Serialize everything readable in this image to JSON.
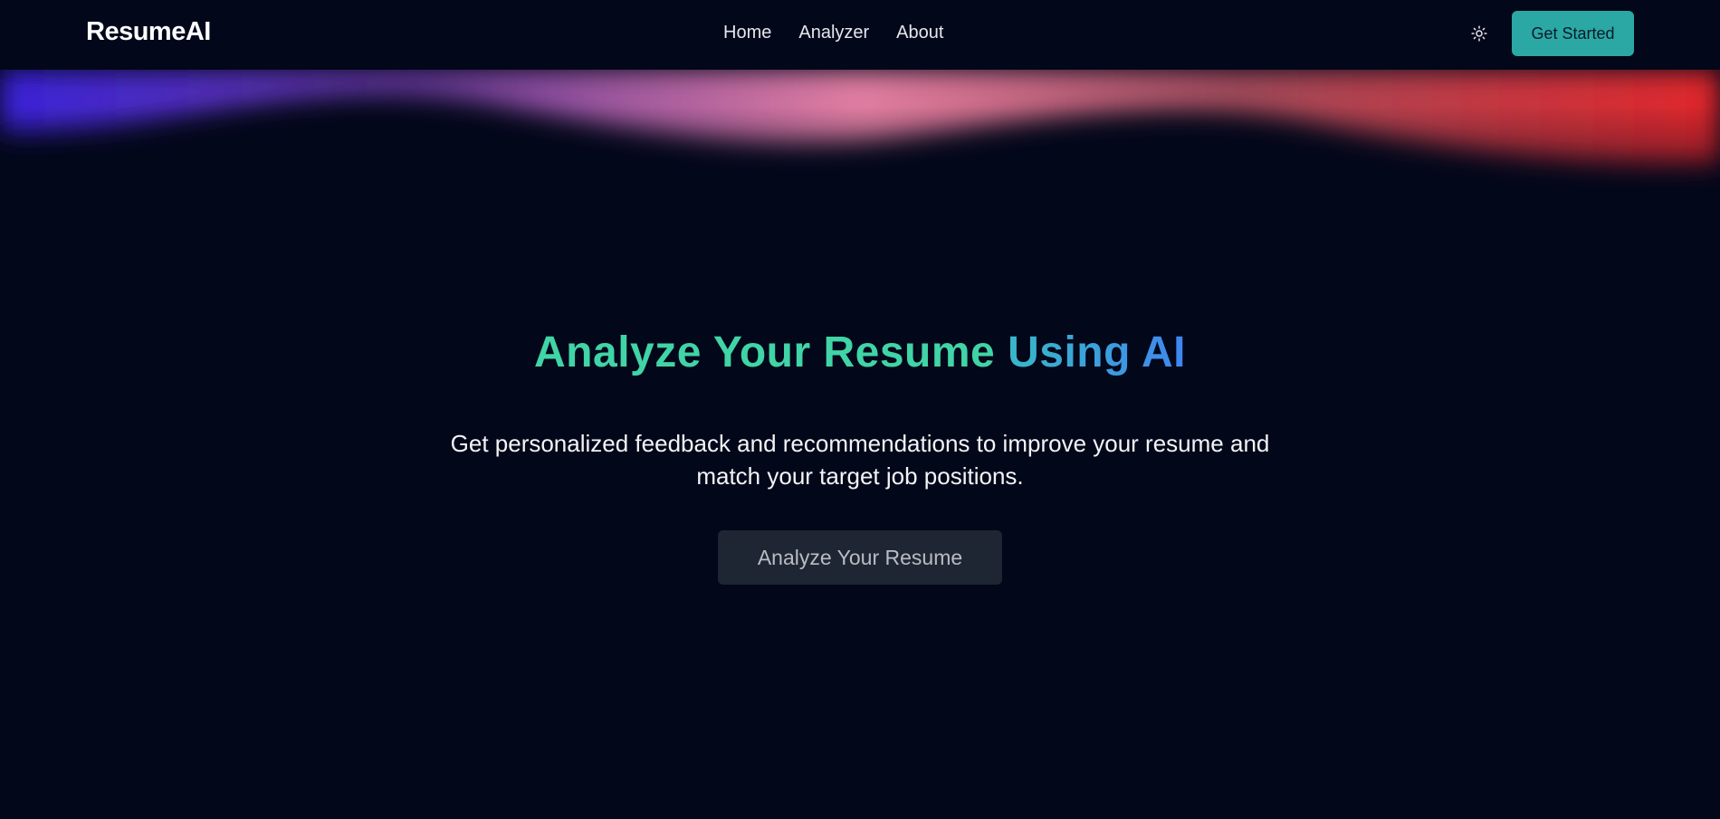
{
  "nav": {
    "logo": "ResumeAI",
    "links": [
      "Home",
      "Analyzer",
      "About"
    ],
    "theme_icon": "sun-icon",
    "cta_label": "Get Started"
  },
  "hero": {
    "title_part_a": "Analyze Your Resume",
    "title_part_b": "Using AI",
    "subtitle_line1": "Get personalized feedback and recommendations to improve your resume and",
    "subtitle_line2": "match your target job positions.",
    "button_label": "Analyze Your Resume"
  },
  "colors": {
    "background": "#03071a",
    "accent_teal": "#2ba8a4",
    "title_green": "#40d4a6",
    "title_blue": "#3f86f0",
    "wave_left": "#3a22d8",
    "wave_mid": "#e07da0",
    "wave_right": "#e0262a"
  }
}
